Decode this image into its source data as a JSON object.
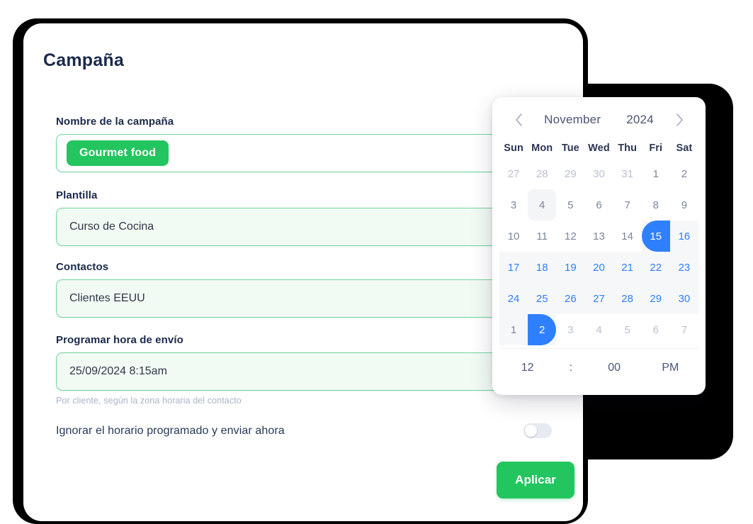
{
  "page": {
    "title": "Campaña"
  },
  "form": {
    "fields": [
      {
        "label": "Nombre de la campaña",
        "value": "Gourmet food",
        "style": "chip"
      },
      {
        "label": "Plantilla",
        "value": "Curso de Cocina",
        "style": "text"
      },
      {
        "label": "Contactos",
        "value": "Clientes EEUU",
        "style": "text"
      },
      {
        "label": "Programar hora de envío",
        "value": "25/09/2024  8:15am",
        "style": "text"
      }
    ],
    "helper_text": "Por cliente, según la zona horaria del contacto",
    "toggle_label": "Ignorar el horario programado y enviar ahora",
    "toggle_state": "off",
    "apply_label": "Aplicar"
  },
  "calendar": {
    "prev_icon": "chevron-left-icon",
    "next_icon": "chevron-right-icon",
    "month": "November",
    "year": "2024",
    "weekdays": [
      "Sun",
      "Mon",
      "Tue",
      "Wed",
      "Thu",
      "Fri",
      "Sat"
    ],
    "days": [
      {
        "n": "27",
        "state": "outside"
      },
      {
        "n": "28",
        "state": "outside"
      },
      {
        "n": "29",
        "state": "outside"
      },
      {
        "n": "30",
        "state": "outside"
      },
      {
        "n": "31",
        "state": "outside"
      },
      {
        "n": "1",
        "state": "normal"
      },
      {
        "n": "2",
        "state": "normal"
      },
      {
        "n": "3",
        "state": "normal"
      },
      {
        "n": "4",
        "state": "hover"
      },
      {
        "n": "5",
        "state": "normal"
      },
      {
        "n": "6",
        "state": "normal"
      },
      {
        "n": "7",
        "state": "normal"
      },
      {
        "n": "8",
        "state": "normal"
      },
      {
        "n": "9",
        "state": "normal"
      },
      {
        "n": "10",
        "state": "normal"
      },
      {
        "n": "11",
        "state": "normal"
      },
      {
        "n": "12",
        "state": "normal"
      },
      {
        "n": "13",
        "state": "normal"
      },
      {
        "n": "14",
        "state": "normal"
      },
      {
        "n": "15",
        "state": "range-start"
      },
      {
        "n": "16",
        "state": "in-range"
      },
      {
        "n": "17",
        "state": "in-range"
      },
      {
        "n": "18",
        "state": "in-range"
      },
      {
        "n": "19",
        "state": "in-range"
      },
      {
        "n": "20",
        "state": "in-range"
      },
      {
        "n": "21",
        "state": "in-range"
      },
      {
        "n": "22",
        "state": "in-range"
      },
      {
        "n": "23",
        "state": "in-range"
      },
      {
        "n": "24",
        "state": "in-range"
      },
      {
        "n": "25",
        "state": "in-range"
      },
      {
        "n": "26",
        "state": "in-range"
      },
      {
        "n": "27",
        "state": "in-range"
      },
      {
        "n": "28",
        "state": "in-range"
      },
      {
        "n": "29",
        "state": "in-range"
      },
      {
        "n": "30",
        "state": "in-range"
      },
      {
        "n": "1",
        "state": "range-pad"
      },
      {
        "n": "2",
        "state": "range-end"
      },
      {
        "n": "3",
        "state": "outside"
      },
      {
        "n": "4",
        "state": "outside"
      },
      {
        "n": "5",
        "state": "outside"
      },
      {
        "n": "6",
        "state": "outside"
      },
      {
        "n": "7",
        "state": "outside"
      }
    ],
    "time": {
      "hour": "12",
      "separator": ":",
      "minute": "00",
      "meridiem": "PM"
    }
  },
  "colors": {
    "accent_green": "#22c55e",
    "accent_blue": "#2f80ff",
    "field_border": "#6fd79a",
    "field_bg": "#f2faf4",
    "title_text": "#1b2a4a",
    "helper_text": "#aab4c8",
    "bezel": "#000000"
  }
}
